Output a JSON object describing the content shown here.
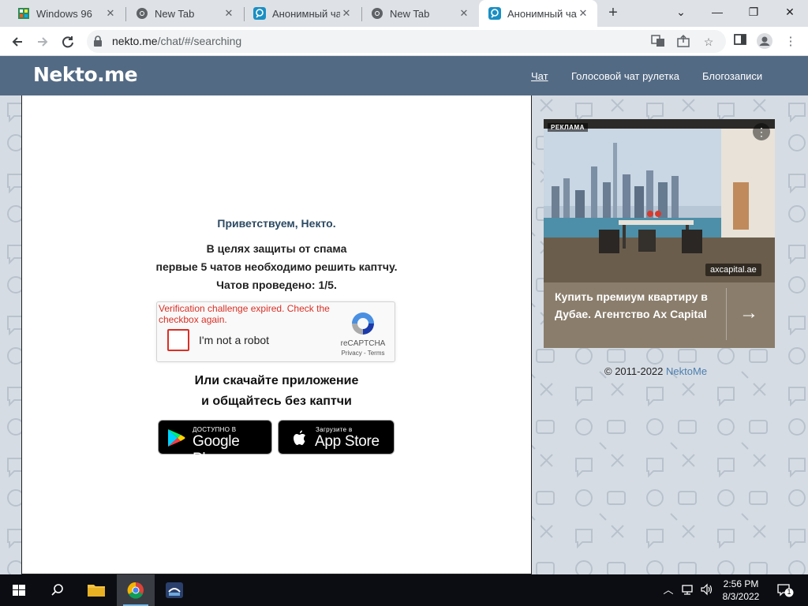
{
  "browser": {
    "tabs": [
      {
        "title": "Windows 96",
        "favicon": "windows96-icon",
        "active": false
      },
      {
        "title": "New Tab",
        "favicon": "chrome-icon",
        "active": false
      },
      {
        "title": "Анонимный чат",
        "favicon": "nekto-icon",
        "active": false
      },
      {
        "title": "New Tab",
        "favicon": "chrome-icon",
        "active": false
      },
      {
        "title": "Анонимный чат",
        "favicon": "nekto-icon",
        "active": true
      }
    ],
    "new_tab_symbol": "+",
    "window_controls": {
      "minimize": "⌄",
      "restore": "—",
      "maximize": "❐",
      "close": "✕"
    },
    "address": {
      "host": "nekto.me",
      "path": "/chat/#/searching"
    }
  },
  "site": {
    "logo": "Nekto.me",
    "nav": [
      {
        "label": "Чат",
        "active": true
      },
      {
        "label": "Голосовой чат рулетка",
        "active": false
      },
      {
        "label": "Блогозаписи",
        "active": false
      }
    ]
  },
  "chat": {
    "greeting": "Приветствуем, Некто.",
    "spam_lines": [
      "В целях защиты от спама",
      "первые 5 чатов необходимо решить каптчу.",
      "Чатов проведено: 1/5."
    ],
    "chats_done": 1,
    "chats_required": 5,
    "recaptcha": {
      "error": "Verification challenge expired. Check the checkbox again.",
      "label": "I'm not a robot",
      "brand": "reCAPTCHA",
      "links": "Privacy - Terms"
    },
    "app_lines": [
      "Или скачайте приложение",
      "и общайтесь без каптчи"
    ],
    "google_play": {
      "small": "ДОСТУПНО В",
      "big": "Google Play"
    },
    "app_store": {
      "small": "Загрузите в",
      "big": "App Store"
    }
  },
  "ad": {
    "badge": "РЕКЛАМА",
    "menu": "⋮",
    "domain": "axcapital.ae",
    "text": "Купить премиум квартиру в Дубае. Агентство Ax Capital",
    "arrow": "→"
  },
  "footer": {
    "copyright": "© 2011-2022",
    "brand_link": "NektoMe"
  },
  "taskbar": {
    "time": "2:56 PM",
    "date": "8/3/2022",
    "notification_count": "1"
  }
}
